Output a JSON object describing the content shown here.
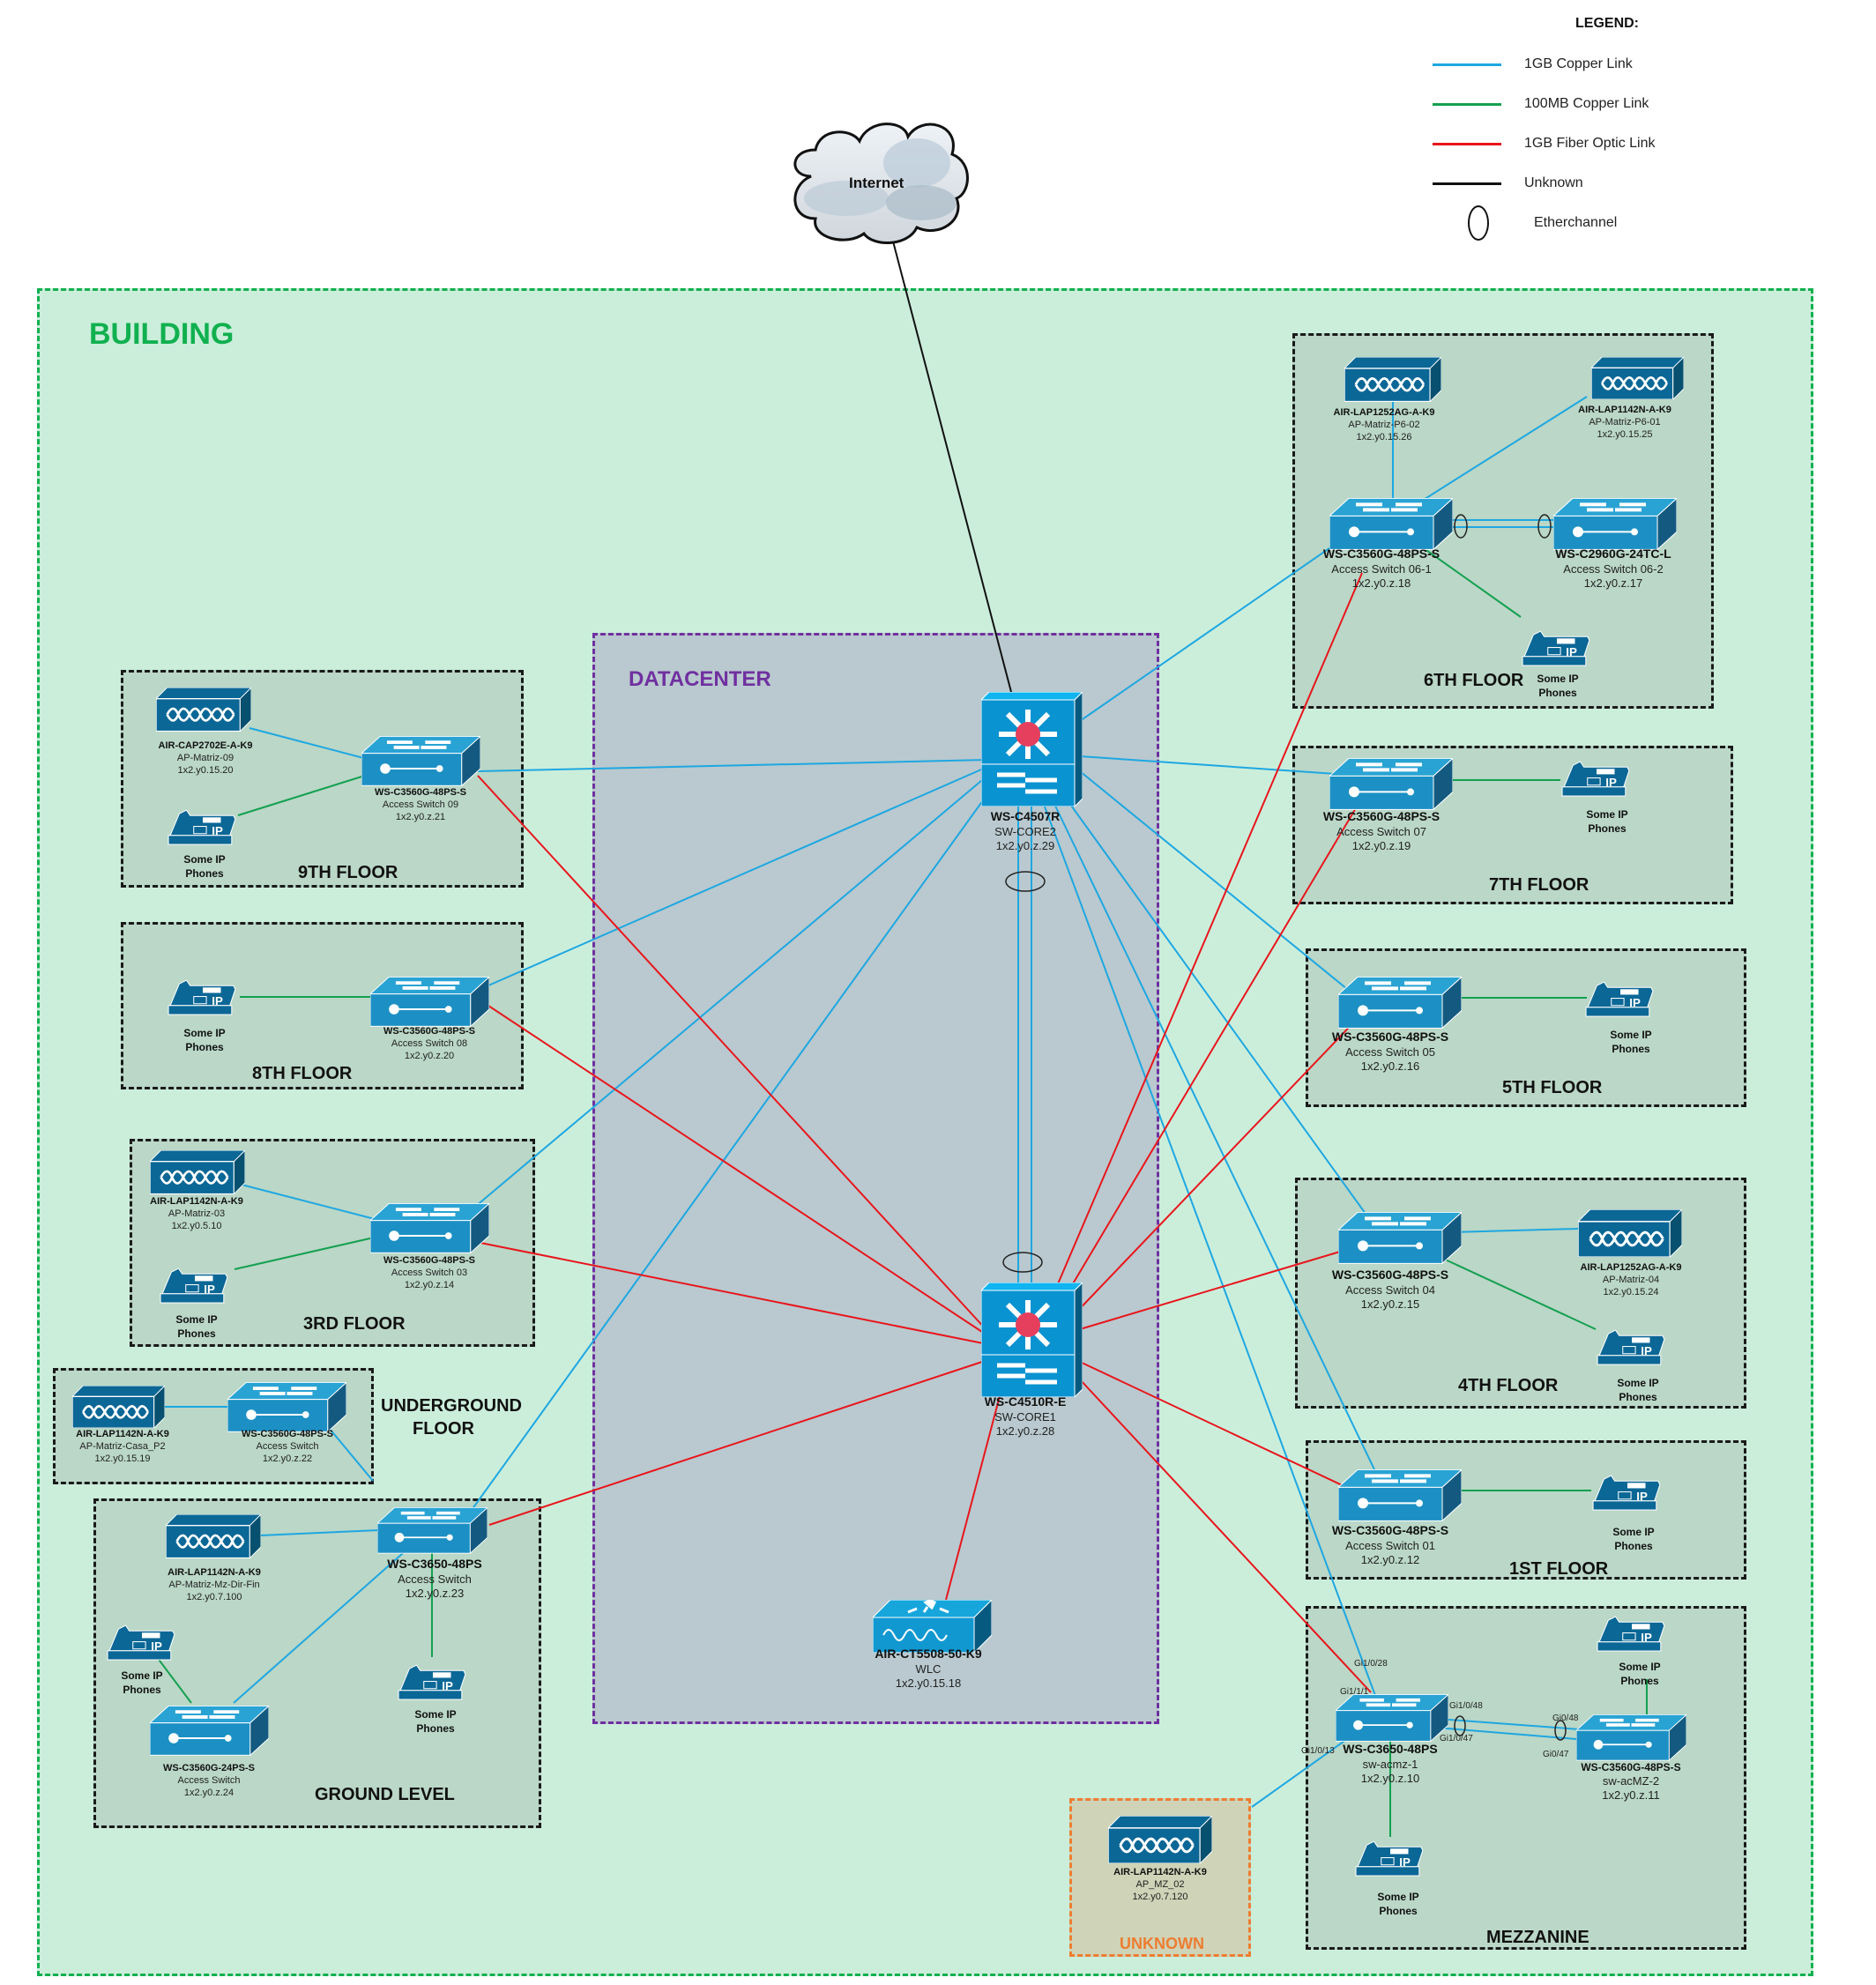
{
  "legend": {
    "title": "LEGEND:",
    "items": [
      {
        "label": "1GB Copper Link",
        "color": "#1ea7e1"
      },
      {
        "label": "100MB Copper Link",
        "color": "#14a050"
      },
      {
        "label": "1GB Fiber Optic Link",
        "color": "#e8161c"
      },
      {
        "label": "Unknown",
        "color": "#111111"
      },
      {
        "label": "Etherchannel",
        "symbol": "ellipse"
      }
    ]
  },
  "internet": {
    "label": "Internet"
  },
  "zones": {
    "building": "BUILDING",
    "datacenter": "DATACENTER",
    "unknown": "UNKNOWN",
    "floor_6": "6TH FLOOR",
    "floor_7": "7TH FLOOR",
    "floor_5": "5TH FLOOR",
    "floor_4": "4TH FLOOR",
    "floor_1": "1ST FLOOR",
    "mezzanine": "MEZZANINE",
    "floor_9": "9TH FLOOR",
    "floor_8": "8TH FLOOR",
    "floor_3": "3RD FLOOR",
    "underground": "UNDERGROUND FLOOR",
    "ground": "GROUND LEVEL"
  },
  "phone_label": "Some IP Phones",
  "devices": {
    "core2": {
      "model": "WS-C4507R",
      "name": "SW-CORE2",
      "ip": "1x2.y0.z.29"
    },
    "core1": {
      "model": "WS-C4510R-E",
      "name": "SW-CORE1",
      "ip": "1x2.y0.z.28"
    },
    "wlc": {
      "model": "AIR-CT5508-50-K9",
      "name": "WLC",
      "ip": "1x2.y0.15.18"
    },
    "ap_p6_02": {
      "model": "AIR-LAP1252AG-A-K9",
      "name": "AP-Matriz-P6-02",
      "ip": "1x2.y0.15.26"
    },
    "ap_p6_01": {
      "model": "AIR-LAP1142N-A-K9",
      "name": "AP-Matriz-P6-01",
      "ip": "1x2.y0.15.25"
    },
    "sw_06_1": {
      "model": "WS-C3560G-48PS-S",
      "name": "Access Switch 06-1",
      "ip": "1x2.y0.z.18"
    },
    "sw_06_2": {
      "model": "WS-C2960G-24TC-L",
      "name": "Access Switch 06-2",
      "ip": "1x2.y0.z.17"
    },
    "sw_07": {
      "model": "WS-C3560G-48PS-S",
      "name": "Access Switch 07",
      "ip": "1x2.y0.z.19"
    },
    "sw_05": {
      "model": "WS-C3560G-48PS-S",
      "name": "Access Switch 05",
      "ip": "1x2.y0.z.16"
    },
    "sw_04": {
      "model": "WS-C3560G-48PS-S",
      "name": "Access Switch 04",
      "ip": "1x2.y0.z.15"
    },
    "ap_04": {
      "model": "AIR-LAP1252AG-A-K9",
      "name": "AP-Matriz-04",
      "ip": "1x2.y0.15.24"
    },
    "sw_01": {
      "model": "WS-C3560G-48PS-S",
      "name": "Access Switch 01",
      "ip": "1x2.y0.z.12"
    },
    "sw_acmz_1": {
      "model": "WS-C3650-48PS",
      "name": "sw-acmz-1",
      "ip": "1x2.y0.z.10"
    },
    "sw_acmz_2": {
      "model": "WS-C3560G-48PS-S",
      "name": "sw-acMZ-2",
      "ip": "1x2.y0.z.11"
    },
    "ap_mz_02": {
      "model": "AIR-LAP1142N-A-K9",
      "name": "AP_MZ_02",
      "ip": "1x2.y0.7.120"
    },
    "ap_09": {
      "model": "AIR-CAP2702E-A-K9",
      "name": "AP-Matriz-09",
      "ip": "1x2.y0.15.20"
    },
    "sw_09": {
      "model": "WS-C3560G-48PS-S",
      "name": "Access Switch 09",
      "ip": "1x2.y0.z.21"
    },
    "sw_08": {
      "model": "WS-C3560G-48PS-S",
      "name": "Access Switch 08",
      "ip": "1x2.y0.z.20"
    },
    "ap_03": {
      "model": "AIR-LAP1142N-A-K9",
      "name": "AP-Matriz-03",
      "ip": "1x2.y0.5.10"
    },
    "sw_03": {
      "model": "WS-C3560G-48PS-S",
      "name": "Access Switch 03",
      "ip": "1x2.y0.z.14"
    },
    "ap_casa_p2": {
      "model": "AIR-LAP1142N-A-K9",
      "name": "AP-Matriz-Casa_P2",
      "ip": "1x2.y0.15.19"
    },
    "sw_ug": {
      "model": "WS-C3560G-48PS-S",
      "name": "Access Switch",
      "ip": "1x2.y0.z.22"
    },
    "sw_gl_3650": {
      "model": "WS-C3650-48PS",
      "name": "Access Switch",
      "ip": "1x2.y0.z.23"
    },
    "ap_mz_dir_fin": {
      "model": "AIR-LAP1142N-A-K9",
      "name": "AP-Matriz-Mz-Dir-Fin",
      "ip": "1x2.y0.7.100"
    },
    "sw_gl_24": {
      "model": "WS-C3560G-24PS-S",
      "name": "Access Switch",
      "ip": "1x2.y0.z.24"
    }
  },
  "ports": {
    "gi1_0_28": "Gi1/0/28",
    "gi1_1_1": "Gi1/1/1",
    "gi1_0_48": "Gi1/0/48",
    "gi1_0_47": "Gi1/0/47",
    "gi1_0_13": "Gi1/0/13",
    "gi0_48": "Gi0/48",
    "gi0_47": "Gi0/47"
  }
}
